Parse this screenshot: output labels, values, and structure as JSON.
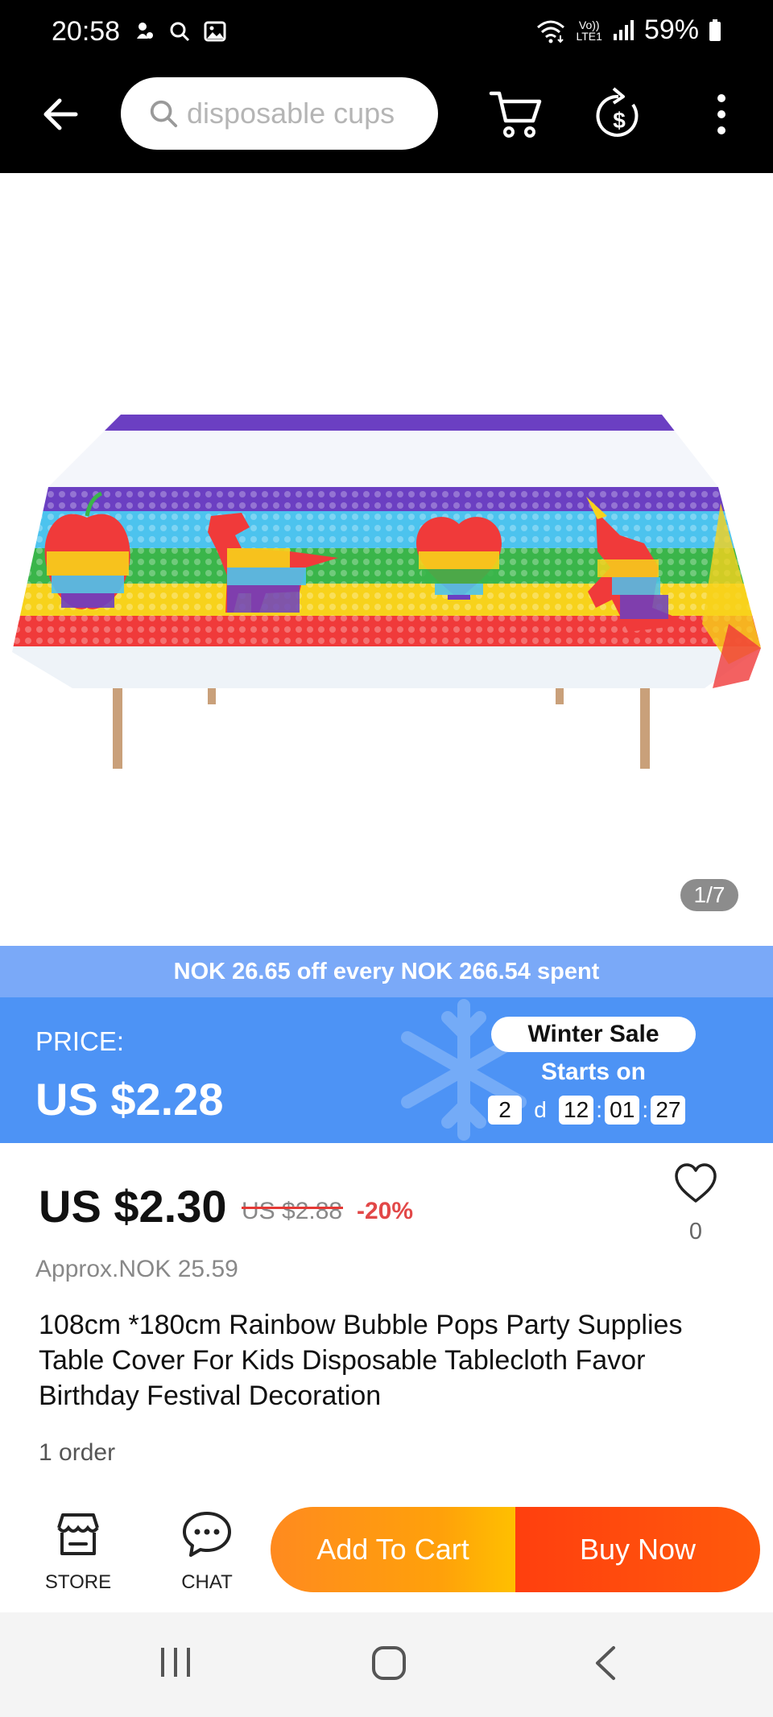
{
  "status_bar": {
    "time": "20:58",
    "network_label_top": "Vo))",
    "network_label_bottom": "LTE1",
    "battery": "59%"
  },
  "toolbar": {
    "search_placeholder": "disposable cups",
    "icons": [
      "back-arrow-icon",
      "search-icon",
      "cart-icon",
      "dollar-cycle-icon",
      "more-vertical-icon"
    ]
  },
  "gallery": {
    "counter": "1/7"
  },
  "promo": {
    "coupon_text": "NOK 26.65 off every NOK 266.54 spent",
    "price_label": "PRICE:",
    "price_value": "US $2.28",
    "sale_name": "Winter Sale",
    "starts_on": "Starts on",
    "countdown": {
      "days": "2",
      "days_unit": "d",
      "hours": "12",
      "minutes": "01",
      "seconds": "27",
      "separator": ":"
    },
    "colors": {
      "strip": "#7aa9f8",
      "banner": "#4d93f5"
    }
  },
  "product": {
    "sale_price": "US $2.30",
    "original_price": "US $2.88",
    "discount": "-20%",
    "wishlist_count": "0",
    "approx_price": "Approx.NOK 25.59",
    "title": "108cm *180cm Rainbow Bubble Pops Party Supplies Table Cover For Kids Disposable Tablecloth Favor Birthday Festival Decoration",
    "orders": "1 order"
  },
  "actions": {
    "store_label": "STORE",
    "chat_label": "CHAT",
    "add_to_cart": "Add To Cart",
    "buy_now": "Buy Now",
    "colors": {
      "add_to_cart": "#ff8a1f",
      "buy_now": "#ff4a0e"
    }
  },
  "nav_bar": {
    "icons": [
      "recents-icon",
      "home-icon",
      "back-icon"
    ]
  }
}
